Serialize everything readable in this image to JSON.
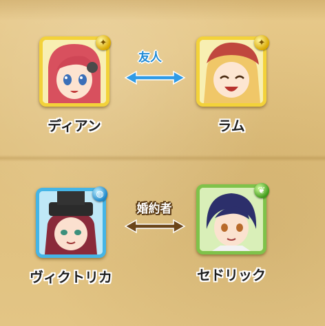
{
  "pairs": [
    {
      "left": {
        "name": "ディアン",
        "attribute": "light",
        "badge_icon": "light-attribute-icon"
      },
      "right": {
        "name": "ラム",
        "attribute": "light",
        "badge_icon": "light-attribute-icon"
      },
      "relation": "友人",
      "arrow_color": "#2f9be6"
    },
    {
      "left": {
        "name": "ヴィクトリカ",
        "attribute": "water",
        "badge_icon": "water-attribute-icon"
      },
      "right": {
        "name": "セドリック",
        "attribute": "wood",
        "badge_icon": "wood-attribute-icon"
      },
      "relation": "婚約者",
      "arrow_color": "#6b4519"
    }
  ],
  "colors": {
    "background": "#e2c482",
    "light_frame": "#f3d23a",
    "water_frame": "#45b5e6",
    "wood_frame": "#7fc24a"
  }
}
